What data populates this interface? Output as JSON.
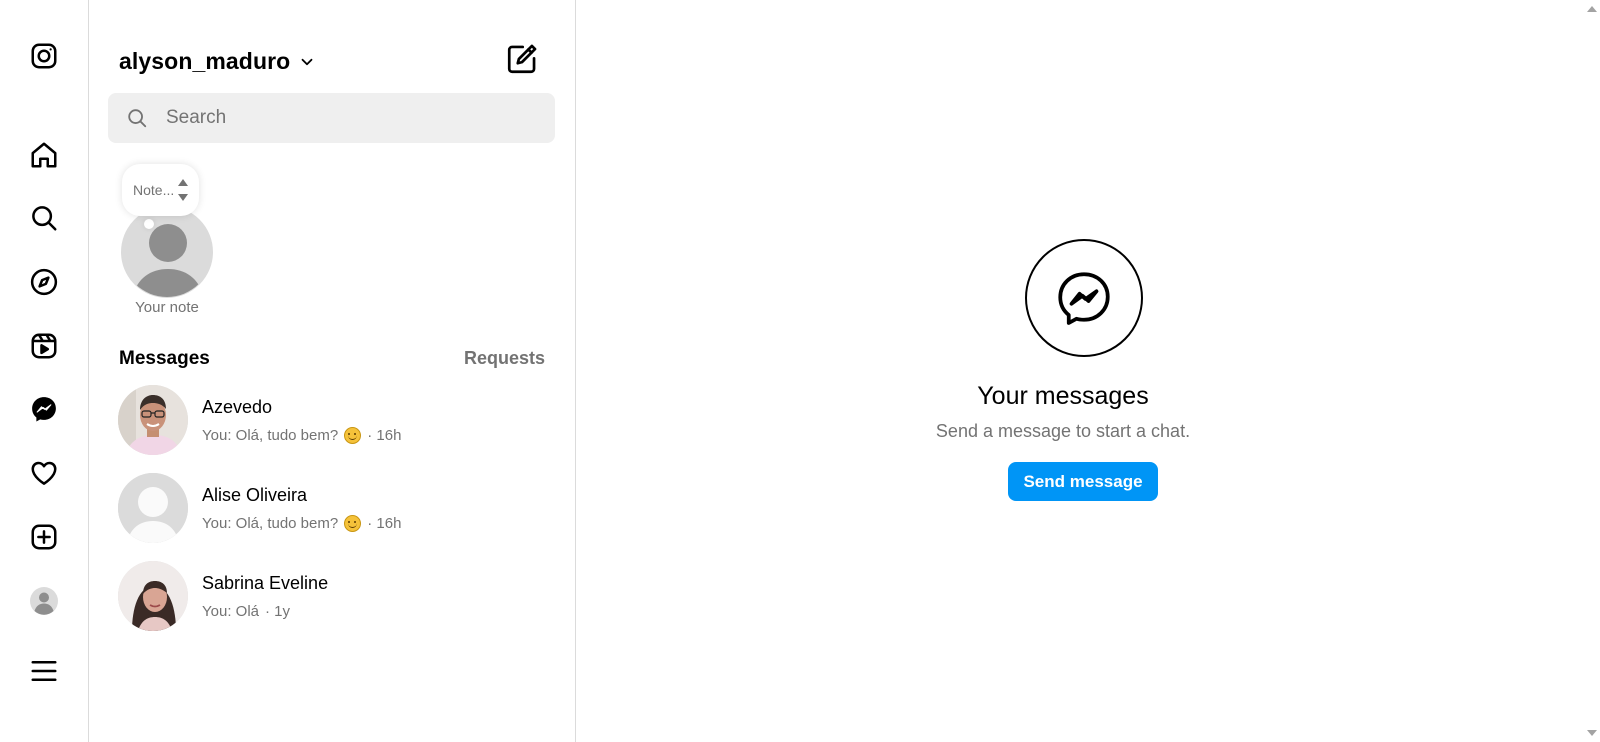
{
  "rail": {
    "icons": [
      "instagram-logo-icon",
      "home-icon",
      "search-icon",
      "explore-icon",
      "reels-icon",
      "messenger-icon",
      "heart-icon",
      "create-icon",
      "profile-icon",
      "menu-icon"
    ]
  },
  "panel": {
    "account_name": "alyson_maduro",
    "search": {
      "placeholder": "Search",
      "value": ""
    },
    "note": {
      "bubble_text": "Note...",
      "label": "Your note"
    },
    "messages_heading": "Messages",
    "requests_label": "Requests",
    "conversations": [
      {
        "name": "Azevedo",
        "preview": "You: Olá, tudo bem?",
        "emoji": true,
        "time": "· 16h"
      },
      {
        "name": "Alise Oliveira",
        "preview": "You: Olá, tudo bem?",
        "emoji": true,
        "time": "· 16h"
      },
      {
        "name": "Sabrina Eveline",
        "preview": "You: Olá",
        "emoji": false,
        "time": "· 1y"
      }
    ]
  },
  "main": {
    "title": "Your messages",
    "subtitle": "Send a message to start a chat.",
    "button_label": "Send message"
  },
  "colors": {
    "accent": "#0095f6",
    "muted_text": "#737373",
    "border": "#dbdbdb",
    "search_bg": "#efefef"
  }
}
